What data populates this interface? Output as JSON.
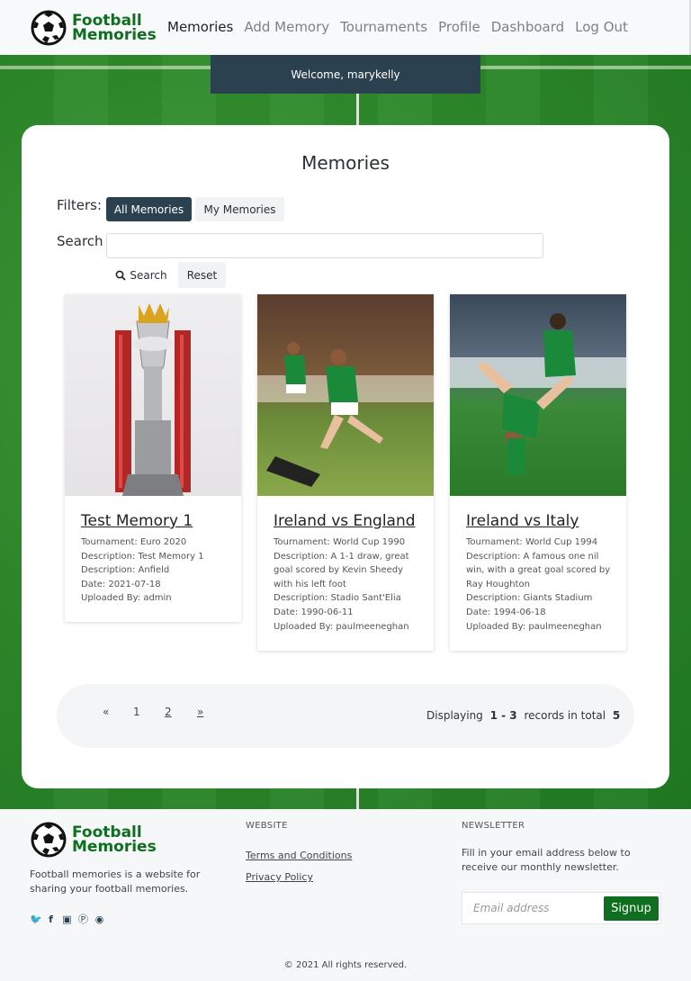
{
  "header": {
    "brand_line1": "Football",
    "brand_line2": "Memories",
    "nav": [
      "Memories",
      "Add Memory",
      "Tournaments",
      "Profile",
      "Dashboard",
      "Log Out"
    ],
    "active_nav": "Memories"
  },
  "welcome": "Welcome, marykelly",
  "main": {
    "title": "Memories",
    "filters_label": "Filters:",
    "filter_all": "All Memories",
    "filter_mine": "My Memories",
    "search_label": "Search",
    "search_value": "",
    "search_button": "Search",
    "reset_button": "Reset"
  },
  "memories": [
    {
      "title": "Test Memory 1",
      "lines": [
        "Tournament: Euro 2020",
        "Description: Test Memory 1",
        "Description: Anfield",
        "Date: 2021-07-18",
        "Uploaded By: admin"
      ]
    },
    {
      "title": "Ireland vs England",
      "lines": [
        "Tournament: World Cup 1990",
        "Description: A 1-1 draw, great goal scored by Kevin Sheedy with his left foot",
        "Description: Stadio Sant'Elia",
        "Date: 1990-06-11",
        "Uploaded By: paulmeeneghan"
      ]
    },
    {
      "title": "Ireland vs Italy",
      "lines": [
        "Tournament: World Cup 1994",
        "Description: A famous one nil win, with a great goal scored by Ray Houghton",
        "Description: Giants Stadium",
        "Date: 1994-06-18",
        "Uploaded By: paulmeeneghan"
      ]
    }
  ],
  "pagination": {
    "prev": "«",
    "pages": [
      "1",
      "2"
    ],
    "next": "»",
    "display_prefix": "Displaying",
    "range": "1 - 3",
    "mid": "records in total",
    "total": "5"
  },
  "footer": {
    "brand_line1": "Football",
    "brand_line2": "Memories",
    "description": "Football memories is a website for sharing your football memories.",
    "website_heading": "WEBSITE",
    "links": [
      "Terms and Conditions",
      "Privacy Policy"
    ],
    "newsletter_heading": "NEWSLETTER",
    "newsletter_text": "Fill in your email address below to receive our monthly newsletter.",
    "email_placeholder": "Email address",
    "signup": "Signup",
    "copyright": "© 2021 All rights reserved."
  },
  "colors": {
    "brand": "#0f6e1f",
    "dark": "#2b4150",
    "pitch": "#2f8a2b"
  }
}
